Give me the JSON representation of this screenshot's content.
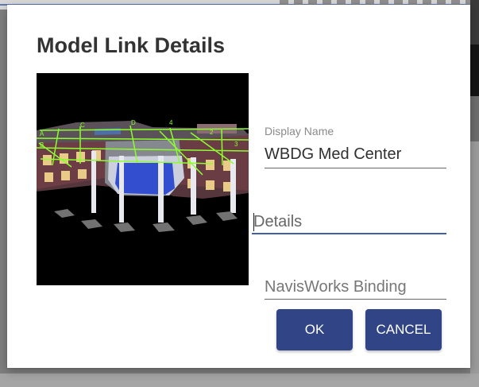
{
  "dialog": {
    "title": "Model Link Details",
    "preview_image": {
      "icon": "building-model-preview",
      "grid_labels": [
        "C",
        "D",
        "4",
        "A",
        "B",
        "2",
        "3"
      ]
    }
  },
  "fields": {
    "display_name": {
      "label": "Display Name",
      "value": "WBDG Med Center"
    },
    "details": {
      "placeholder": "Details",
      "value": ""
    },
    "navisworks_binding": {
      "placeholder": "NavisWorks Binding",
      "value": ""
    }
  },
  "actions": {
    "ok_label": "OK",
    "cancel_label": "CANCEL"
  },
  "colors": {
    "primary": "#314586",
    "focused_underline": "#3f5fa8",
    "preview_background": "#000000",
    "grid": "#8cff2f"
  }
}
